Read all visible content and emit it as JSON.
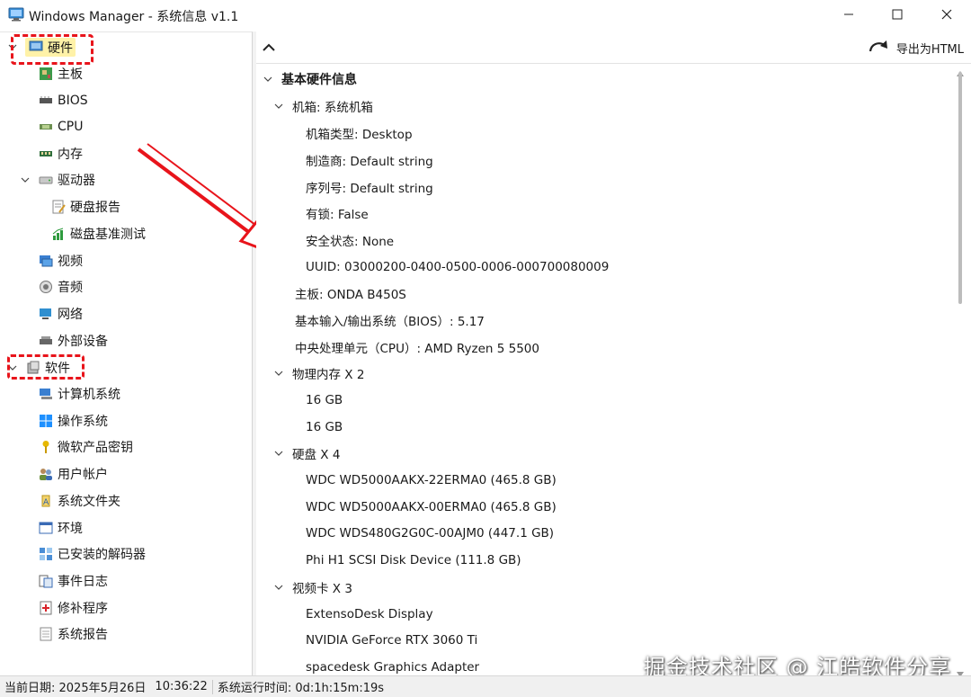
{
  "window": {
    "title": "Windows Manager - 系统信息 v1.1"
  },
  "tree": {
    "items": [
      {
        "label": "硬件",
        "icon": "hardware-icon",
        "level": 0,
        "expanded": true
      },
      {
        "label": "主板",
        "icon": "motherboard-icon",
        "level": 1
      },
      {
        "label": "BIOS",
        "icon": "bios-chip-icon",
        "level": 1
      },
      {
        "label": "CPU",
        "icon": "cpu-icon",
        "level": 1
      },
      {
        "label": "内存",
        "icon": "memory-icon",
        "level": 1
      },
      {
        "label": "驱动器",
        "icon": "drive-icon",
        "level": 1,
        "expanded": true
      },
      {
        "label": "硬盘报告",
        "icon": "disk-report-icon",
        "level": 2
      },
      {
        "label": "磁盘基准测试",
        "icon": "benchmark-chart-icon",
        "level": 2
      },
      {
        "label": "视频",
        "icon": "video-icon",
        "level": 1
      },
      {
        "label": "音频",
        "icon": "audio-icon",
        "level": 1
      },
      {
        "label": "网络",
        "icon": "network-icon",
        "level": 1
      },
      {
        "label": "外部设备",
        "icon": "peripheral-icon",
        "level": 1
      },
      {
        "label": "软件",
        "icon": "software-icon",
        "level": 0,
        "expanded": true
      },
      {
        "label": "计算机系统",
        "icon": "computer-icon",
        "level": 1
      },
      {
        "label": "操作系统",
        "icon": "windows-logo-icon",
        "level": 1
      },
      {
        "label": "微软产品密钥",
        "icon": "key-icon",
        "level": 1
      },
      {
        "label": "用户帐户",
        "icon": "users-icon",
        "level": 1
      },
      {
        "label": "系统文件夹",
        "icon": "folder-icon",
        "level": 1
      },
      {
        "label": "环境",
        "icon": "window-icon",
        "level": 1
      },
      {
        "label": "已安装的解码器",
        "icon": "codec-icon",
        "level": 1
      },
      {
        "label": "事件日志",
        "icon": "event-log-icon",
        "level": 1
      },
      {
        "label": "修补程序",
        "icon": "patch-icon",
        "level": 1
      },
      {
        "label": "系统报告",
        "icon": "report-icon",
        "level": 1
      }
    ]
  },
  "toolbar": {
    "export_label": "导出为HTML"
  },
  "info": {
    "rows": [
      {
        "text": "基本硬件信息",
        "level": 0,
        "expander": true,
        "bold": true
      },
      {
        "text": "机箱: 系统机箱",
        "level": 1,
        "expander": true
      },
      {
        "text": "机箱类型: Desktop",
        "level": 2
      },
      {
        "text": "制造商: Default string",
        "level": 2
      },
      {
        "text": "序列号: Default string",
        "level": 2
      },
      {
        "text": "有锁: False",
        "level": 2
      },
      {
        "text": "安全状态: None",
        "level": 2
      },
      {
        "text": "UUID: 03000200-0400-0500-0006-000700080009",
        "level": 2
      },
      {
        "text": "主板: ONDA B450S",
        "level": 1
      },
      {
        "text": "基本输入/输出系统（BIOS）: 5.17",
        "level": 1
      },
      {
        "text": "中央处理单元（CPU）: AMD Ryzen 5 5500",
        "level": 1
      },
      {
        "text": "物理内存 X 2",
        "level": 1,
        "expander": true
      },
      {
        "text": "16 GB",
        "level": 2
      },
      {
        "text": "16 GB",
        "level": 2
      },
      {
        "text": "硬盘 X 4",
        "level": 1,
        "expander": true
      },
      {
        "text": "WDC WD5000AAKX-22ERMA0 (465.8 GB)",
        "level": 2
      },
      {
        "text": "WDC WD5000AAKX-00ERMA0 (465.8 GB)",
        "level": 2
      },
      {
        "text": "WDC WDS480G2G0C-00AJM0 (447.1 GB)",
        "level": 2
      },
      {
        "text": "Phi H1 SCSI Disk Device (111.8 GB)",
        "level": 2
      },
      {
        "text": "视频卡 X 3",
        "level": 1,
        "expander": true
      },
      {
        "text": "ExtensoDesk Display",
        "level": 2
      },
      {
        "text": "NVIDIA GeForce RTX 3060 Ti",
        "level": 2
      },
      {
        "text": "spacedesk Graphics Adapter",
        "level": 2
      }
    ]
  },
  "watermark": "掘金技术社区 @ 江皓软件分享",
  "status": {
    "date": "当前日期: 2025年5月26日",
    "time": "10:36:22",
    "uptime": "系统运行时间: 0d:1h:15m:19s"
  },
  "colors": {
    "annotation_red": "#e8141b",
    "selected_highlight": "#fff2a8",
    "software_label": "#1a63c9"
  }
}
